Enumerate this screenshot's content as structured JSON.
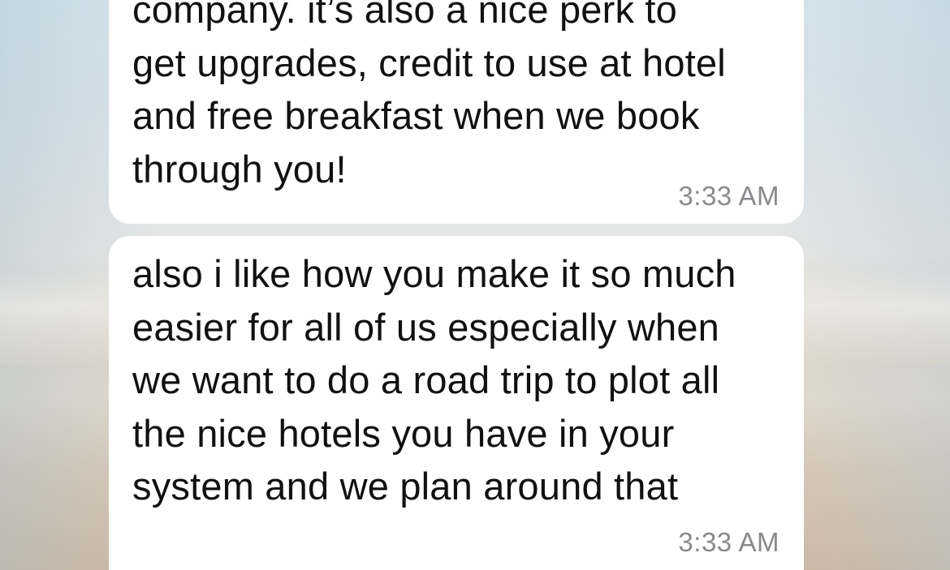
{
  "messages": [
    {
      "text": "company. it’s also a nice perk to\nget upgrades, credit to use at hotel\nand free breakfast when we book\nthrough you!",
      "time": "3:33 AM"
    },
    {
      "text": "also i like how you make it so much\neasier for all of us especially when\nwe want to do a road trip to plot all\nthe nice hotels you have in your\nsystem and we plan around that",
      "time": "3:33 AM"
    }
  ],
  "colors": {
    "bubble": "#ffffff",
    "text": "#111111",
    "timestamp": "#8a8a8e"
  }
}
